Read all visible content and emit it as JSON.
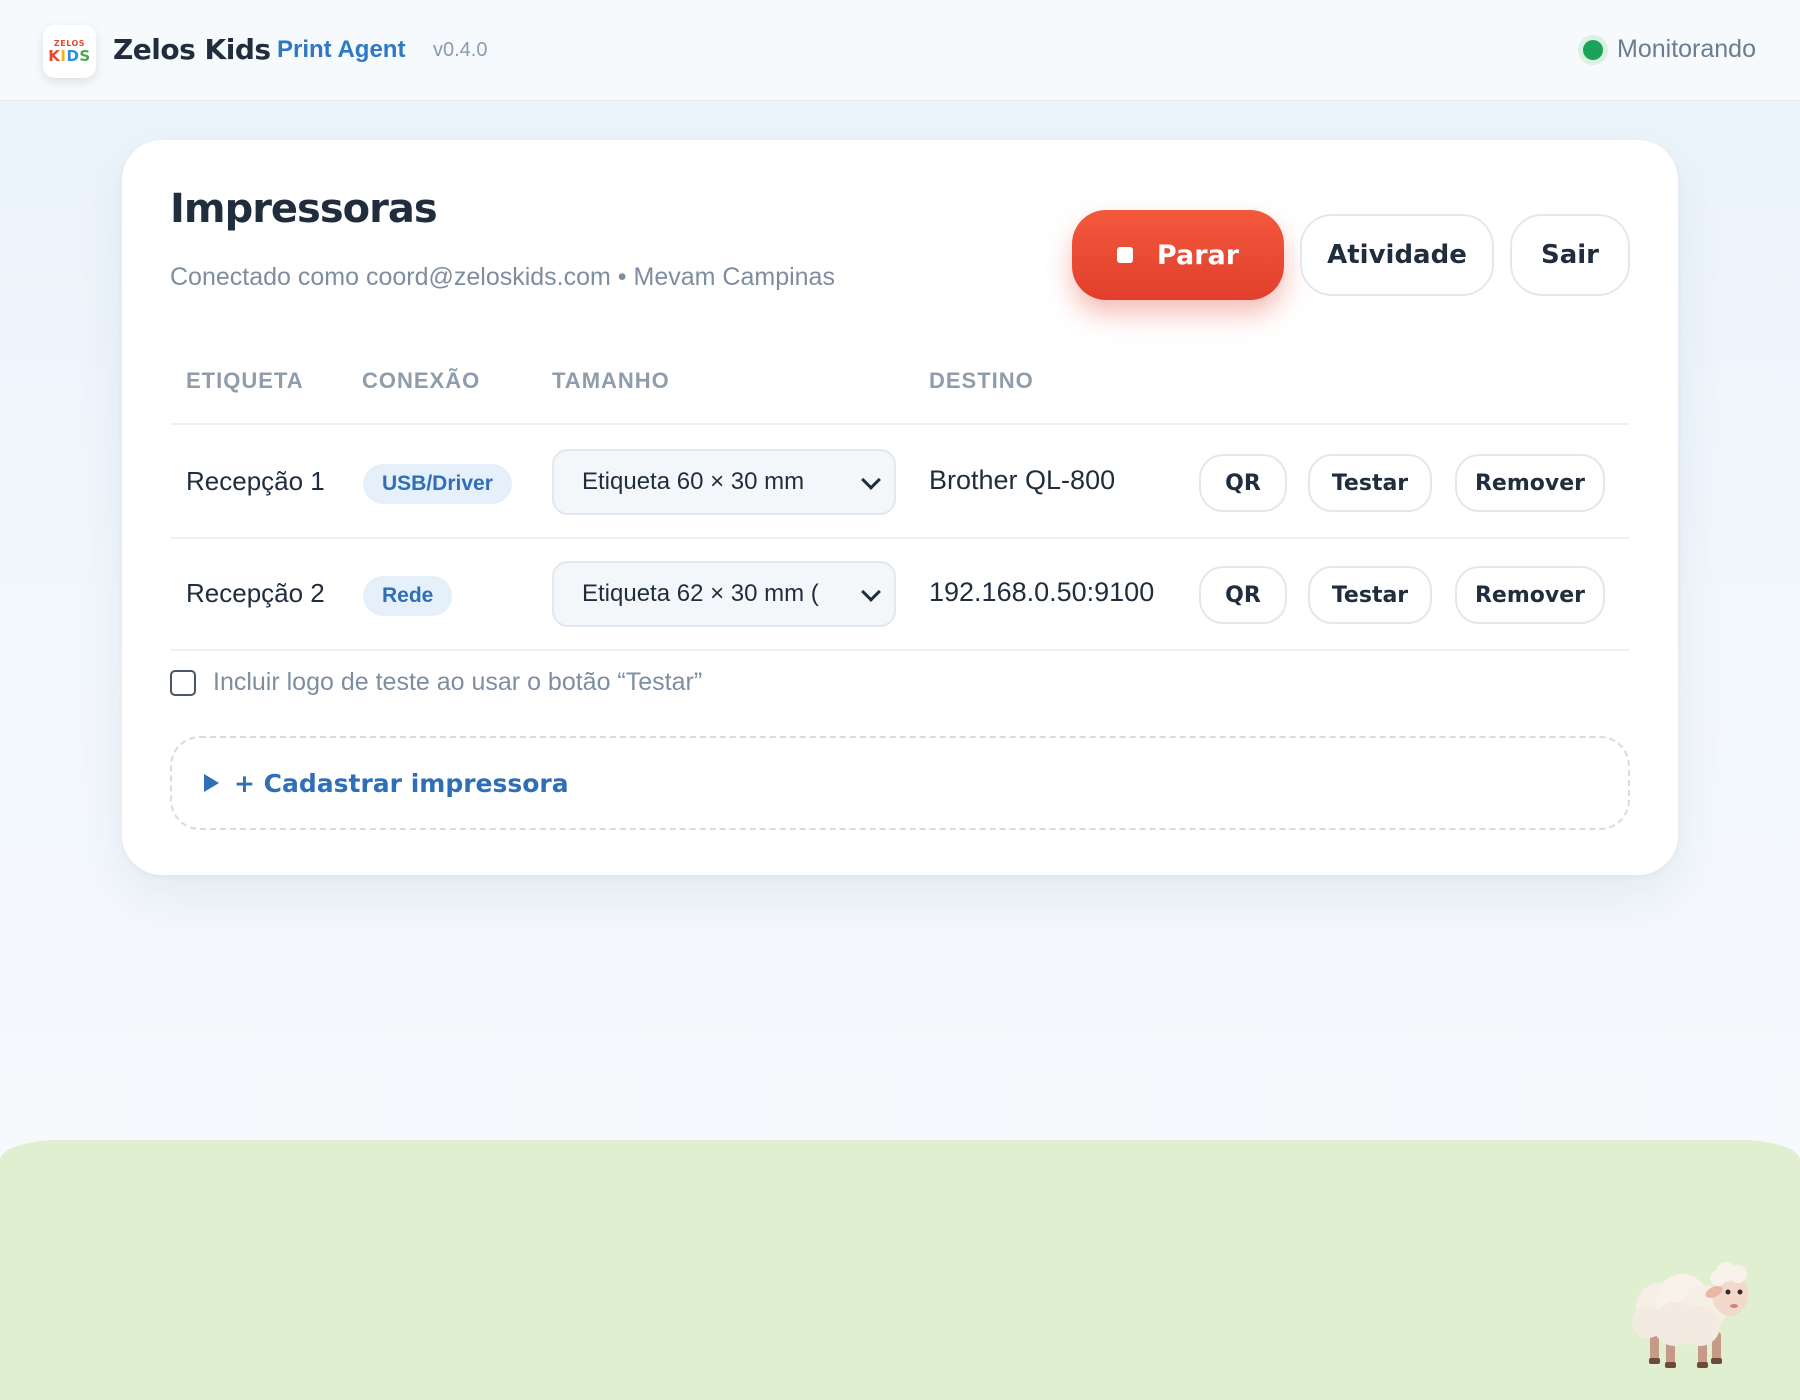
{
  "header": {
    "logo_small": "ZELOS",
    "logo_kids": [
      "K",
      "I",
      "D",
      "S"
    ],
    "brand": "Zelos Kids",
    "product": "Print Agent",
    "version": "v0.4.0",
    "status": "Monitorando",
    "status_color": "#1ba35a"
  },
  "card": {
    "title": "Impressoras",
    "subtitle": "Conectado como coord@zeloskids.com • Mevam Campinas",
    "buttons": {
      "stop": "Parar",
      "activity": "Atividade",
      "exit": "Sair"
    },
    "columns": {
      "label": "ETIQUETA",
      "connection": "CONEXÃO",
      "size": "TAMANHO",
      "destination": "DESTINO"
    },
    "printers": [
      {
        "label": "Recepção 1",
        "connection": "USB/Driver",
        "size": "Etiqueta 60 × 30 mm",
        "destination": "Brother QL-800",
        "qr": "QR",
        "test": "Testar",
        "remove": "Remover"
      },
      {
        "label": "Recepção 2",
        "connection": "Rede",
        "size": "Etiqueta 62 × 30 mm (",
        "destination": "192.168.0.50:9100",
        "qr": "QR",
        "test": "Testar",
        "remove": "Remover"
      }
    ],
    "include_logo_label": "Incluir logo de teste ao usar o botão “Testar”",
    "include_logo_checked": false,
    "add_printer": "+ Cadastrar impressora"
  },
  "colors": {
    "accent": "#2f6fb8",
    "danger": "#e13f2c",
    "ground": "#e0efcf"
  },
  "icons": {
    "status": "status-dot-icon",
    "stop": "stop-square-icon",
    "select": "chevron-down-icon",
    "add": "triangle-right-icon",
    "mascot": "sheep-illustration"
  }
}
